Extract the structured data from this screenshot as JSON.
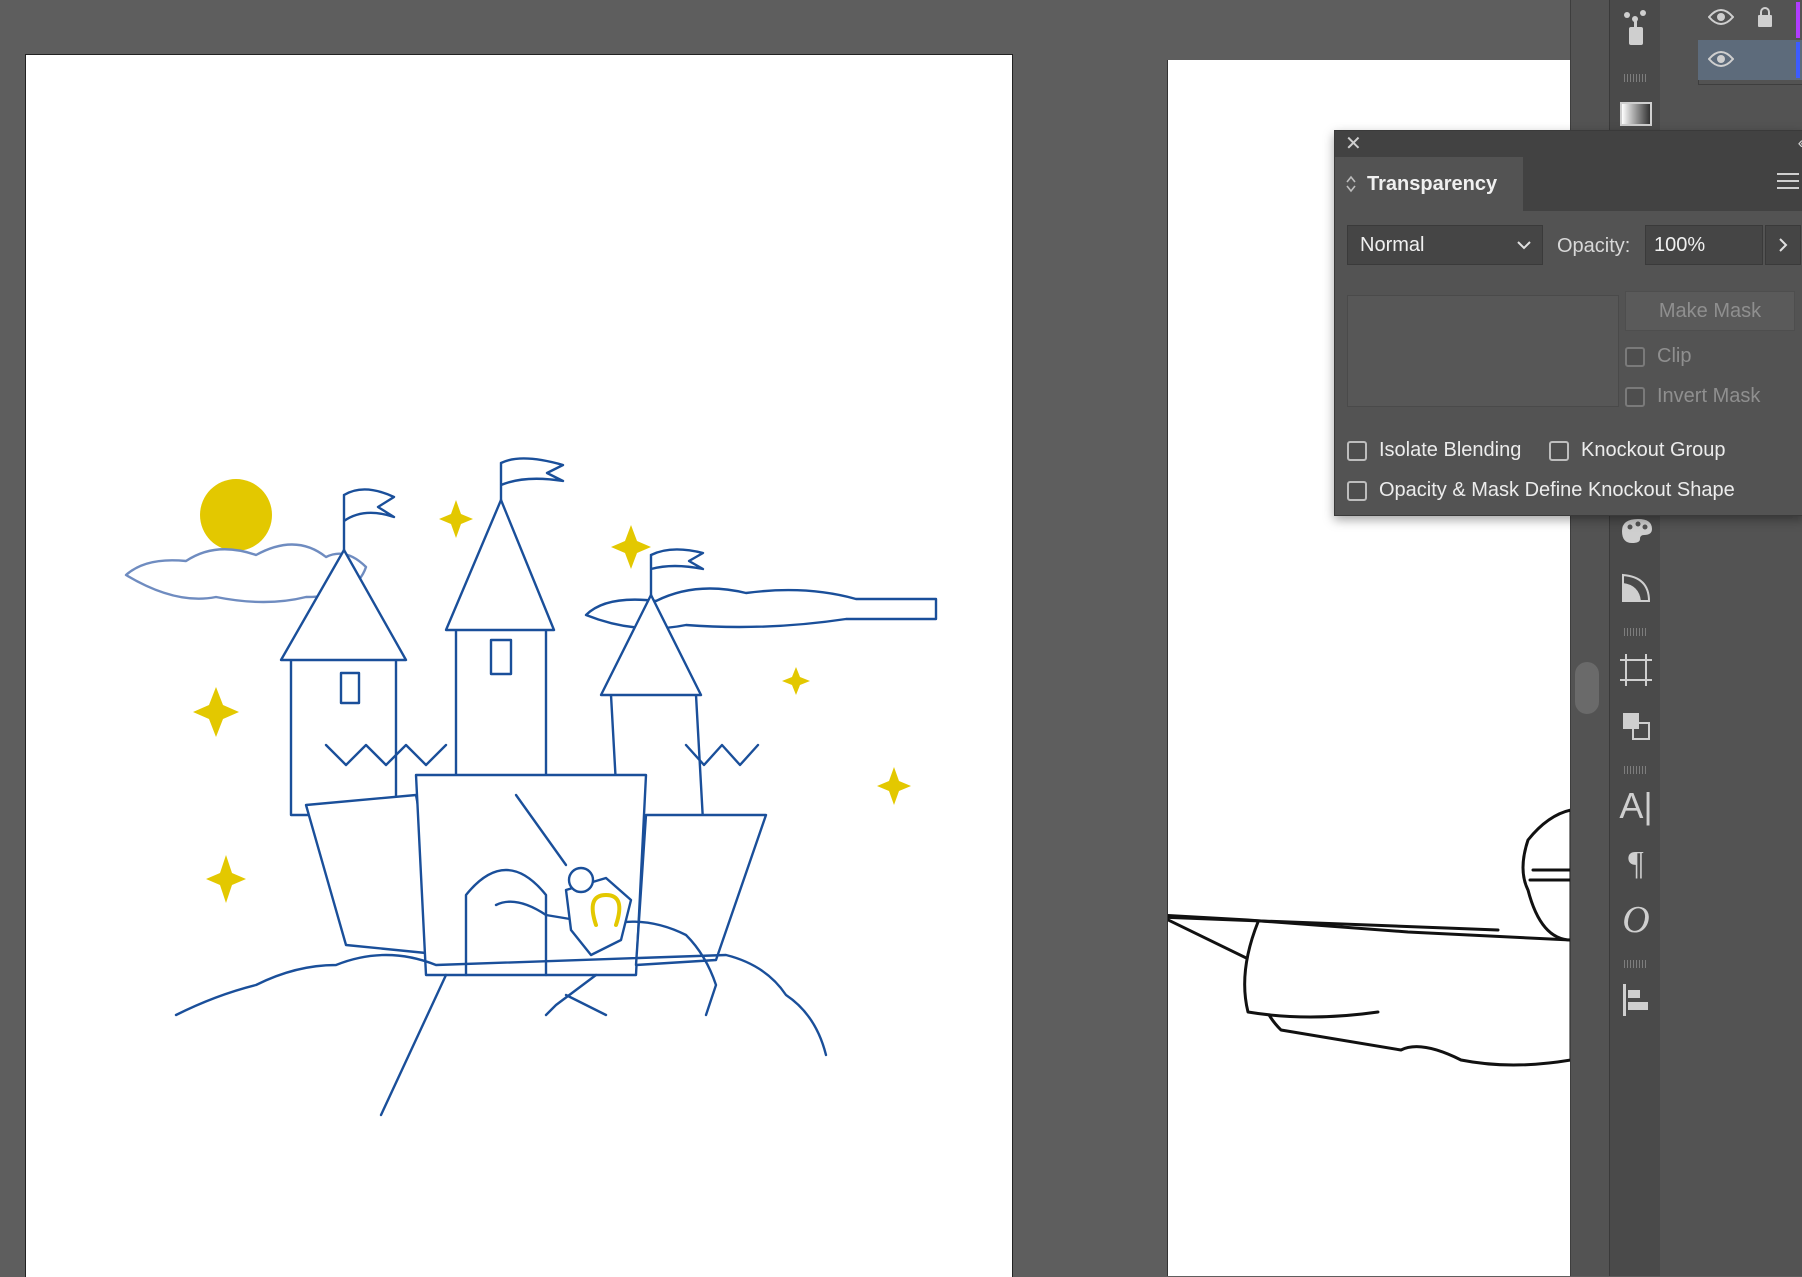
{
  "transparency_panel": {
    "title": "Transparency",
    "blend_mode": "Normal",
    "opacity_label": "Opacity:",
    "opacity_value": "100%",
    "make_mask_label": "Make Mask",
    "clip_label": "Clip",
    "invert_mask_label": "Invert Mask",
    "isolate_blending_label": "Isolate Blending",
    "knockout_group_label": "Knockout Group",
    "opacity_mask_knockout_label": "Opacity & Mask Define Knockout Shape",
    "clip_checked": false,
    "invert_mask_checked": false,
    "isolate_blending_checked": false,
    "knockout_group_checked": false,
    "opacity_mask_knockout_checked": false
  },
  "toolbar": {
    "tools": [
      "symbol-sprayer-icon",
      "gradient-icon",
      "color-guide-icon",
      "image-trace-icon",
      "artboards-icon",
      "pathfinder-icon",
      "character-icon",
      "paragraph-icon",
      "opentype-icon",
      "align-icon"
    ]
  },
  "layers": {
    "rows": [
      {
        "visible": true,
        "locked": true,
        "color": "#b03cff"
      },
      {
        "visible": true,
        "locked": false,
        "color": "#3c5cff"
      }
    ]
  },
  "colors": {
    "line_blue": "#1a4f9a",
    "accent_yellow": "#e3c800",
    "workspace": "#5e5e5e",
    "panel": "#535353"
  }
}
